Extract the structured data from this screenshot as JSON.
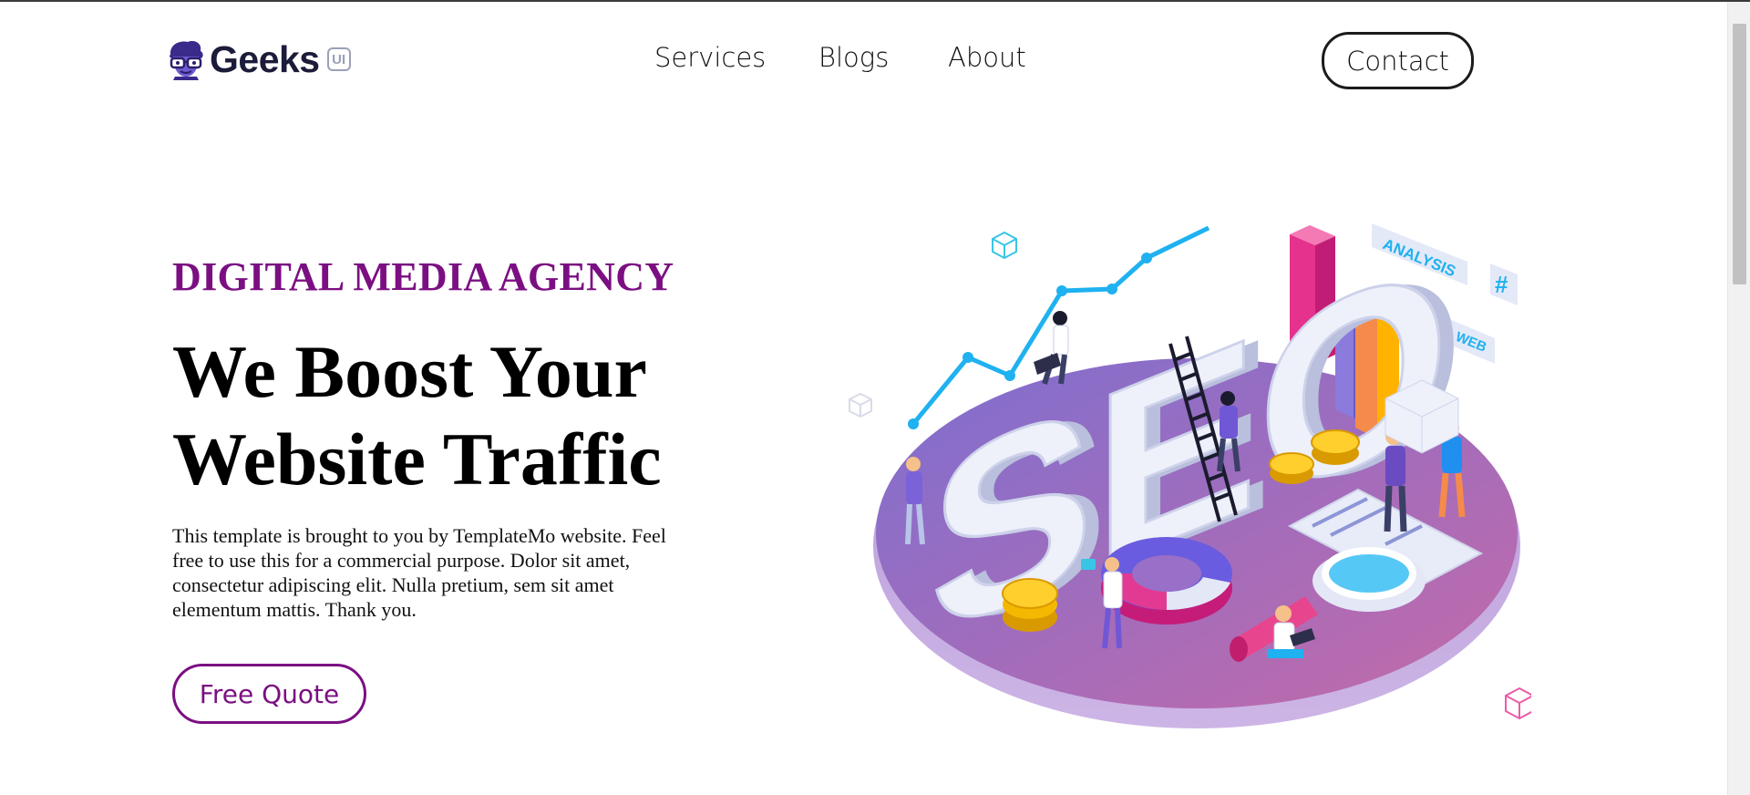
{
  "header": {
    "logo_text": "Geeks",
    "logo_badge": "UI",
    "nav": {
      "services": "Services",
      "blogs": "Blogs",
      "about": "About"
    },
    "contact_label": "Contact"
  },
  "hero": {
    "eyebrow": "DIGITAL MEDIA AGENCY",
    "headline_line1": "We Boost Your",
    "headline_line2": "Website Traffic",
    "body": "This template is brought to you by TemplateMo website. Feel free to use this for a commercial purpose. Dolor sit amet, consectetur adipiscing elit. Nulla pretium, sem sit amet elementum mattis. Thank you.",
    "cta_label": "Free Quote"
  },
  "illustration": {
    "big_letters": "SEO",
    "tags": [
      "ANALYSIS",
      "WEB",
      "#"
    ],
    "icon": "seo-isometric-illustration"
  },
  "colors": {
    "accent": "#7b0f82",
    "logo_text": "#1b1b3a",
    "platform": "#9a6fc8"
  }
}
